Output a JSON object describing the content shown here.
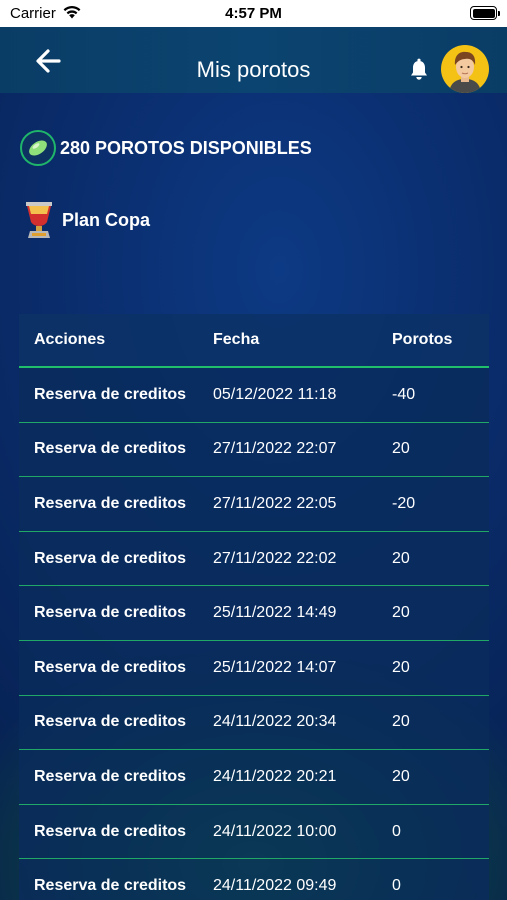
{
  "status_bar": {
    "carrier": "Carrier",
    "time": "4:57 PM"
  },
  "nav": {
    "title": "Mis porotos",
    "back_icon": "arrow-left-icon",
    "bell_icon": "bell-icon"
  },
  "summary": {
    "points_text": "280 POROTOS DISPONIBLES",
    "plan_text": "Plan Copa"
  },
  "table": {
    "headers": {
      "actions": "Acciones",
      "date": "Fecha",
      "points": "Porotos"
    },
    "rows": [
      {
        "action": "Reserva de creditos",
        "date": "05/12/2022 11:18",
        "points": "-40"
      },
      {
        "action": "Reserva de creditos",
        "date": "27/11/2022 22:07",
        "points": "20"
      },
      {
        "action": "Reserva de creditos",
        "date": "27/11/2022 22:05",
        "points": "-20"
      },
      {
        "action": "Reserva de creditos",
        "date": "27/11/2022 22:02",
        "points": "20"
      },
      {
        "action": "Reserva de creditos",
        "date": "25/11/2022 14:49",
        "points": "20"
      },
      {
        "action": "Reserva de creditos",
        "date": "25/11/2022 14:07",
        "points": "20"
      },
      {
        "action": "Reserva de creditos",
        "date": "24/11/2022 20:34",
        "points": "20"
      },
      {
        "action": "Reserva de creditos",
        "date": "24/11/2022 20:21",
        "points": "20"
      },
      {
        "action": "Reserva de creditos",
        "date": "24/11/2022 10:00",
        "points": "0"
      },
      {
        "action": "Reserva de creditos",
        "date": "24/11/2022 09:49",
        "points": "0"
      }
    ]
  },
  "colors": {
    "accent_green": "#1fbf6b",
    "nav_bg": "#0a3d66",
    "avatar_bg": "#f4c214"
  }
}
